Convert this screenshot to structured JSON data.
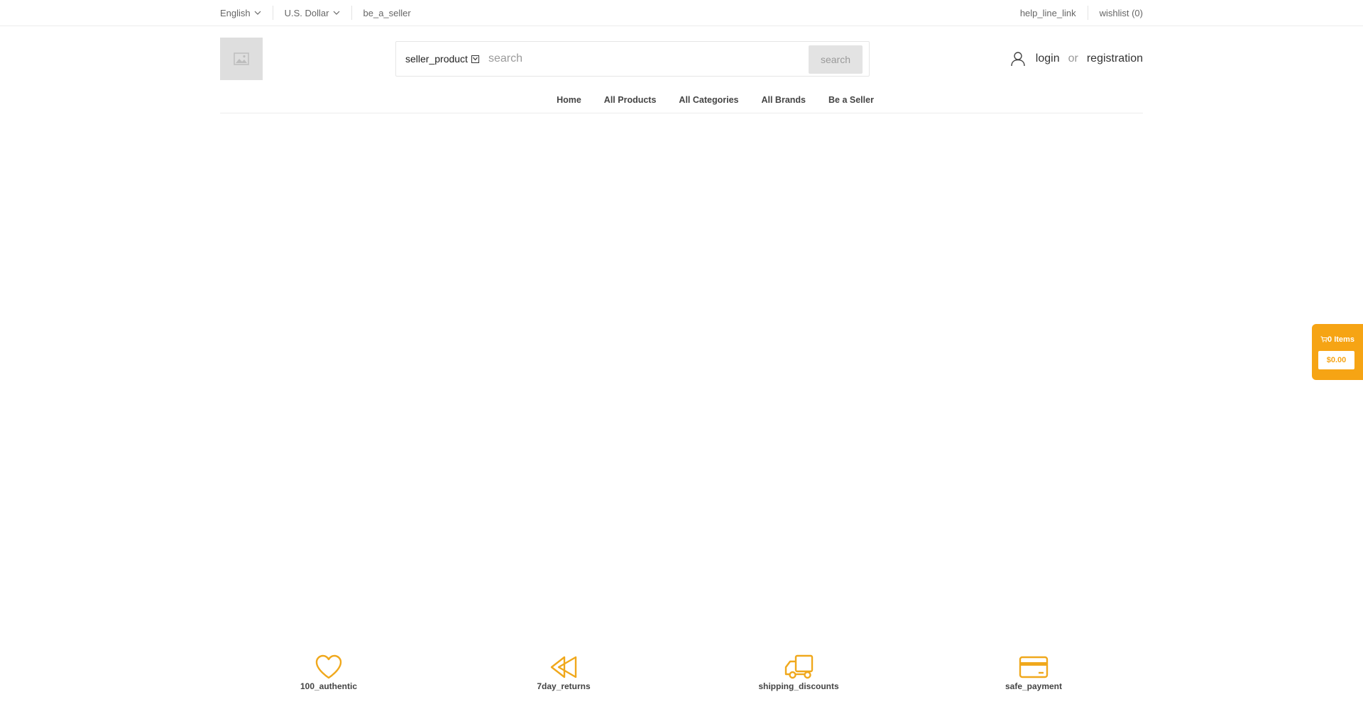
{
  "topbar": {
    "language": "English",
    "currency": "U.S. Dollar",
    "be_a_seller": "be_a_seller",
    "help_line": "help_line_link",
    "wishlist": "wishlist (0)"
  },
  "search": {
    "scope": "seller_product",
    "placeholder": "search",
    "button": "search"
  },
  "auth": {
    "login": "login",
    "or": "or",
    "registration": "registration"
  },
  "nav": {
    "items": [
      {
        "label": "Home"
      },
      {
        "label": "All Products"
      },
      {
        "label": "All Categories"
      },
      {
        "label": "All Brands"
      },
      {
        "label": "Be a Seller"
      }
    ]
  },
  "cart": {
    "items": "0 Items",
    "total": "$0.00"
  },
  "features": [
    {
      "label": "100_authentic",
      "icon": "heart-icon"
    },
    {
      "label": "7day_returns",
      "icon": "rewind-icon"
    },
    {
      "label": "shipping_discounts",
      "icon": "truck-icon"
    },
    {
      "label": "safe_payment",
      "icon": "credit-card-icon"
    }
  ],
  "colors": {
    "accent": "#f6a414",
    "text": "#333333",
    "muted": "#666666"
  }
}
